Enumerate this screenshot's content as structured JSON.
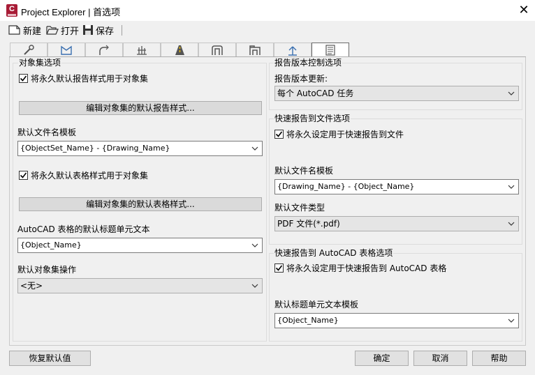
{
  "window": {
    "logo_text": "C",
    "title": "Project Explorer | 首选项",
    "close_glyph": "✕"
  },
  "toolbar": {
    "new_label": "新建",
    "open_label": "打开",
    "save_label": "保存"
  },
  "tabs": [
    {
      "icon": "wrench-icon"
    },
    {
      "icon": "surface-icon"
    },
    {
      "icon": "alignment-icon"
    },
    {
      "icon": "sample-lines-icon"
    },
    {
      "icon": "road-icon"
    },
    {
      "icon": "pipe-network-icon"
    },
    {
      "icon": "pressure-pipe-icon"
    },
    {
      "icon": "survey-point-icon"
    },
    {
      "icon": "report-settings-icon",
      "active": true
    }
  ],
  "left": {
    "group_title": "对象集选项",
    "check_report_style_label": "将永久默认报告样式用于对象集",
    "edit_report_style_button": "编辑对象集的默认报告样式...",
    "filename_template_label": "默认文件名模板",
    "filename_template_value": "{ObjectSet_Name} - {Drawing_Name}",
    "check_table_style_label": "将永久默认表格样式用于对象集",
    "edit_table_style_button": "编辑对象集的默认表格样式...",
    "table_title_label": "AutoCAD 表格的默认标题单元文本",
    "table_title_value": "{Object_Name}",
    "default_action_label": "默认对象集操作",
    "default_action_value": "<无>"
  },
  "right": {
    "version_group_title": "报告版本控制选项",
    "version_update_label": "报告版本更新:",
    "version_update_value": "每个 AutoCAD 任务",
    "file_group_title": "快速报告到文件选项",
    "file_check_label": "将永久设定用于快速报告到文件",
    "file_template_label": "默认文件名模板",
    "file_template_value": "{Drawing_Name} - {Object_Name}",
    "file_type_label": "默认文件类型",
    "file_type_value": "PDF 文件(*.pdf)",
    "table_group_title": "快速报告到 AutoCAD 表格选项",
    "table_check_label": "将永久设定用于快速报告到 AutoCAD 表格",
    "table_title_label": "默认标题单元文本模板",
    "table_title_value": "{Object_Name}"
  },
  "footer": {
    "restore_defaults": "恢复默认值",
    "ok": "确定",
    "cancel": "取消",
    "help": "帮助"
  }
}
